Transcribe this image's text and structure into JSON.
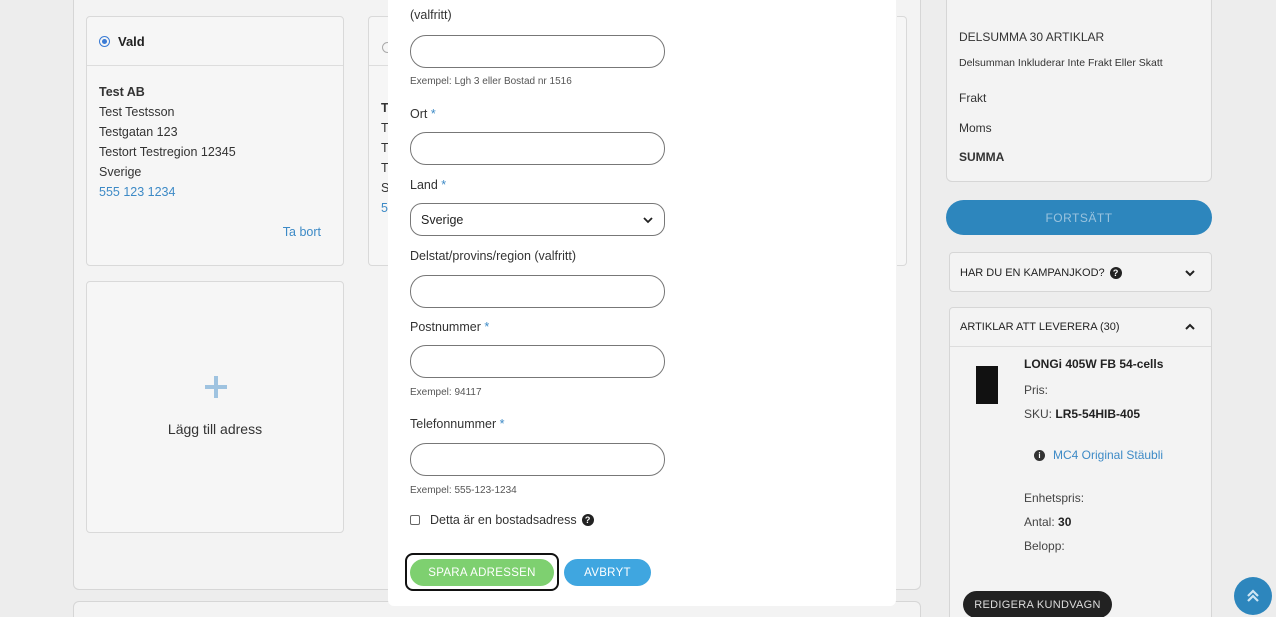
{
  "addresses": {
    "selected_card": {
      "status_label": "Vald",
      "name": "Test AB",
      "contact": "Test Testsson",
      "street": "Testgatan 123",
      "city_line": "Testort Testregion 12345",
      "country": "Sverige",
      "phone": "555 123 1234",
      "remove_label": "Ta bort"
    },
    "second_card_partial": {
      "lines": [
        "T",
        "T",
        "T",
        "T",
        "S",
        "5"
      ]
    },
    "add_card": {
      "label": "Lägg till adress"
    }
  },
  "modal": {
    "line2_label": "(valfritt)",
    "line2_hint": "Exempel: Lgh 3 eller Bostad nr 1516",
    "city_label": "Ort",
    "country_label": "Land",
    "country_value": "Sverige",
    "region_label": "Delstat/provins/region (valfritt)",
    "postcode_label": "Postnummer",
    "postcode_hint": "Exempel: 94117",
    "phone_label": "Telefonnummer",
    "phone_hint": "Exempel: 555-123-1234",
    "required_marker": "*",
    "residential_label": "Detta är en bostadsadress",
    "help_glyph": "?",
    "save_label": "SPARA ADRESSEN",
    "cancel_label": "AVBRYT"
  },
  "summary": {
    "subtotal_label": "DELSUMMA 30 ARTIKLAR",
    "subtotal_note": "Delsumman Inkluderar Inte Frakt Eller Skatt",
    "shipping_label": "Frakt",
    "tax_label": "Moms",
    "total_label": "SUMMA",
    "continue_label": "FORTSÄTT"
  },
  "promo": {
    "label": "HAR DU EN KAMPANJKOD?",
    "help_glyph": "?"
  },
  "items": {
    "header": "ARTIKLAR ATT LEVERERA (30)",
    "product": {
      "name": "LONGi 405W FB 54-cells",
      "price_label": "Pris:",
      "sku_label": "SKU:",
      "sku_value": "LR5-54HIB-405",
      "option": "MC4 Original Stäubli",
      "info_glyph": "i",
      "unit_price_label": "Enhetspris:",
      "qty_label": "Antal:",
      "qty_value": "30",
      "amount_label": "Belopp:"
    },
    "edit_cart_label": "REDIGERA KUNDVAGN"
  },
  "colors": {
    "accent_blue": "#2d86bd",
    "save_green": "#7ed070",
    "cancel_blue": "#3fa6e0",
    "link_blue": "#3d8ac6"
  }
}
